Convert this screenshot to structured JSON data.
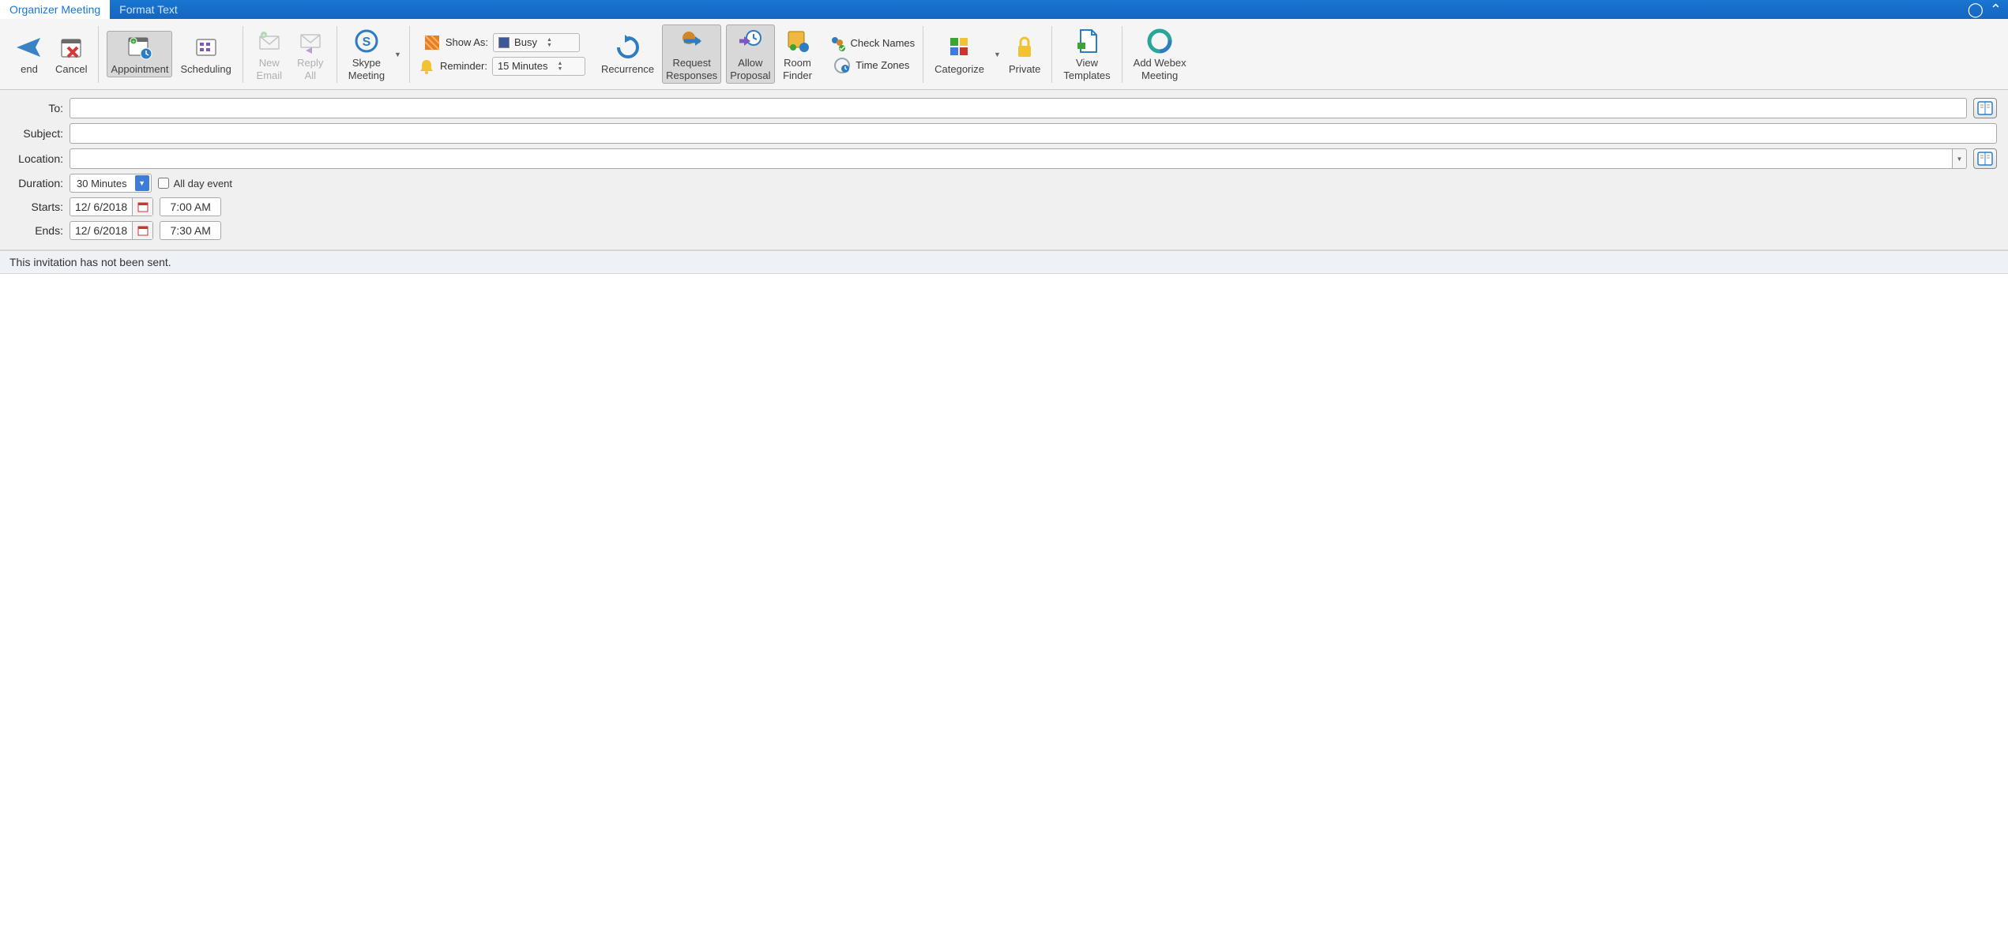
{
  "tabs": {
    "organizer": "Organizer Meeting",
    "format": "Format Text"
  },
  "ribbon": {
    "send": "end",
    "cancel": "Cancel",
    "appointment": "Appointment",
    "scheduling": "Scheduling",
    "new_email": "New\nEmail",
    "reply_all": "Reply\nAll",
    "skype": "Skype\nMeeting",
    "show_as_label": "Show As:",
    "show_as_value": "Busy",
    "reminder_label": "Reminder:",
    "reminder_value": "15 Minutes",
    "recurrence": "Recurrence",
    "request_responses": "Request\nResponses",
    "allow_proposal": "Allow\nProposal",
    "room_finder": "Room\nFinder",
    "check_names": "Check Names",
    "time_zones": "Time Zones",
    "categorize": "Categorize",
    "private": "Private",
    "view_templates": "View\nTemplates",
    "add_webex": "Add Webex\nMeeting"
  },
  "form": {
    "to_label": "To:",
    "to_value": "",
    "subject_label": "Subject:",
    "subject_value": "",
    "location_label": "Location:",
    "location_value": "",
    "duration_label": "Duration:",
    "duration_value": "30 Minutes",
    "allday_label": "All day event",
    "starts_label": "Starts:",
    "starts_date": "12/  6/2018",
    "starts_time": "7:00 AM",
    "ends_label": "Ends:",
    "ends_date": "12/  6/2018",
    "ends_time": "7:30 AM"
  },
  "status": "This invitation has not been sent."
}
